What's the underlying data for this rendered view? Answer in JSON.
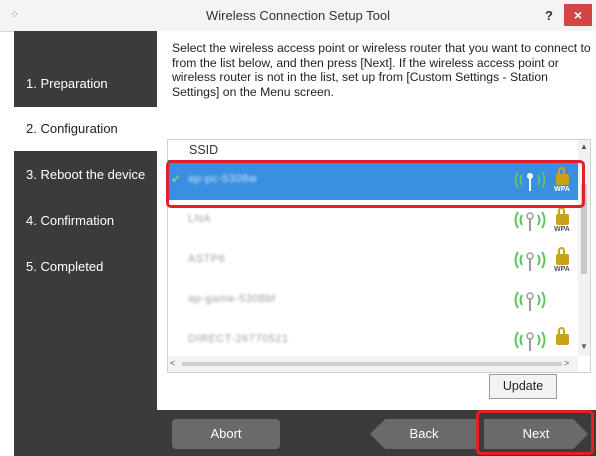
{
  "window": {
    "title": "Wireless Connection Setup Tool",
    "help_label": "?",
    "close_label": "×"
  },
  "sidebar": {
    "steps": [
      {
        "label": "1. Preparation",
        "active": false
      },
      {
        "label": "2. Configuration",
        "active": true
      },
      {
        "label": "3. Reboot the device",
        "active": false
      },
      {
        "label": "4. Confirmation",
        "active": false
      },
      {
        "label": "5. Completed",
        "active": false
      }
    ]
  },
  "main": {
    "instructions": "Select the wireless access point or wireless router that you want to connect to from the list below, and then press [Next]. If the wireless access point or wireless router is not in the list, set up from [Custom Settings - Station Settings] on the Menu screen.",
    "list": {
      "column_header": "SSID",
      "rows": [
        {
          "ssid": "ap-pc-5308w",
          "selected": true,
          "connected": true,
          "secured": true,
          "security_label": "WPA",
          "signal_bars": 4
        },
        {
          "ssid": "LNA",
          "selected": false,
          "connected": false,
          "secured": true,
          "security_label": "WPA",
          "signal_bars": 3
        },
        {
          "ssid": "ASTP6",
          "selected": false,
          "connected": false,
          "secured": true,
          "security_label": "WPA",
          "signal_bars": 3
        },
        {
          "ssid": "ap-game-5308bf",
          "selected": false,
          "connected": false,
          "secured": false,
          "security_label": "",
          "signal_bars": 3
        },
        {
          "ssid": "DIRECT-26770521",
          "selected": false,
          "connected": false,
          "secured": true,
          "security_label": "",
          "signal_bars": 3
        }
      ]
    },
    "update_label": "Update"
  },
  "footer": {
    "abort_label": "Abort",
    "back_label": "Back",
    "next_label": "Next"
  },
  "colors": {
    "sidebar_bg": "#3b3b3b",
    "selection_blue": "#3a8fe0",
    "highlight_red": "#e0202a",
    "close_red": "#d24545",
    "signal_green": "#5cc55c",
    "lock_gold": "#c9a21a"
  },
  "icons": {
    "app": "wifi-app-icon",
    "connected": "check-icon",
    "signal": "signal-antenna-icon",
    "lock": "lock-icon"
  }
}
